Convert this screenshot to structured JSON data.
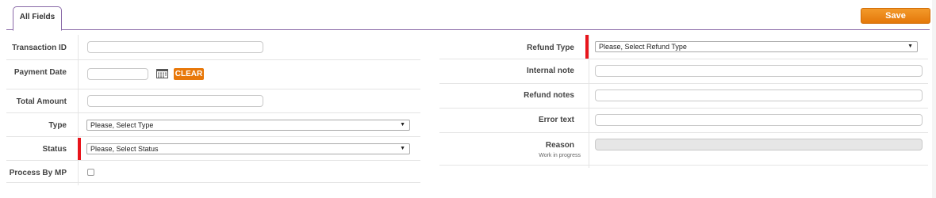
{
  "tabs": [
    {
      "label": "All Fields",
      "active": true
    }
  ],
  "toolbar": {
    "save_label": "Save"
  },
  "accent_color": "#e4780a",
  "required_color": "#e8141b",
  "left_fields": {
    "transaction_id": {
      "label": "Transaction ID",
      "value": ""
    },
    "payment_date": {
      "label": "Payment Date",
      "value": "",
      "clear_label": "CLEAR",
      "icon": "calendar-icon"
    },
    "total_amount": {
      "label": "Total Amount",
      "value": ""
    },
    "type": {
      "label": "Type",
      "selected": "Please, Select Type"
    },
    "status": {
      "label": "Status",
      "selected": "Please, Select Status",
      "required": true
    },
    "process_by_mp": {
      "label": "Process By MP",
      "checked": false
    }
  },
  "right_fields": {
    "refund_type": {
      "label": "Refund Type",
      "selected": "Please, Select Refund Type",
      "required": true
    },
    "internal_note": {
      "label": "Internal note",
      "value": ""
    },
    "refund_notes": {
      "label": "Refund notes",
      "value": ""
    },
    "error_text": {
      "label": "Error text",
      "value": ""
    },
    "reason": {
      "label": "Reason",
      "sublabel": "Work in progress",
      "value": "",
      "disabled": true
    }
  }
}
